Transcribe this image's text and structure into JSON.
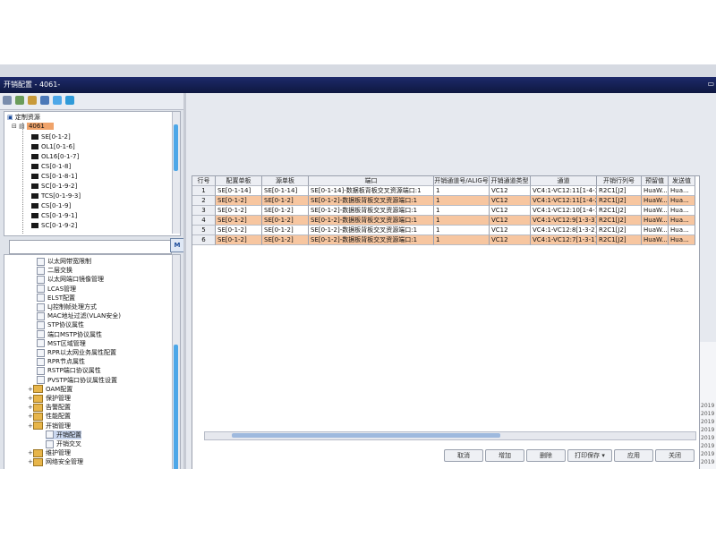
{
  "window": {
    "title": "开销配置 - 4061-"
  },
  "tree": {
    "root_label": "定制资源",
    "ne_label": "4061",
    "items": [
      {
        "label": "SE[0-1-2]"
      },
      {
        "label": "OL1[0-1-6]"
      },
      {
        "label": "OL16[0-1-7]"
      },
      {
        "label": "CS[0-1-8]"
      },
      {
        "label": "CS[0-1-8-1]"
      },
      {
        "label": "SC[0-1-9-2]"
      },
      {
        "label": "TCS[0-1-9-3]"
      },
      {
        "label": "CS[0-1-9]"
      },
      {
        "label": "CS[0-1-9-1]"
      },
      {
        "label": "SC[0-1-9-2]"
      }
    ]
  },
  "search": {
    "placeholder": "",
    "button_label": "M"
  },
  "function_tree": [
    {
      "label": "以太网带宽限制",
      "type": "leaf",
      "indent": 1
    },
    {
      "label": "二层交换",
      "type": "leaf",
      "indent": 1
    },
    {
      "label": "以太网端口镜像管理",
      "type": "leaf",
      "indent": 1
    },
    {
      "label": "LCAS管理",
      "type": "leaf",
      "indent": 1
    },
    {
      "label": "ELST配置",
      "type": "leaf",
      "indent": 1
    },
    {
      "label": "LJ控制帧处理方式",
      "type": "leaf",
      "indent": 1
    },
    {
      "label": "MAC地址过滤(VLAN安全)",
      "type": "leaf",
      "indent": 1
    },
    {
      "label": "STP协议属性",
      "type": "leaf",
      "indent": 1
    },
    {
      "label": "端口MSTP协议属性",
      "type": "leaf",
      "indent": 1
    },
    {
      "label": "MST区域管理",
      "type": "leaf",
      "indent": 1
    },
    {
      "label": "RPR以太网业务属性配置",
      "type": "leaf",
      "indent": 1
    },
    {
      "label": "RPR节点属性",
      "type": "leaf",
      "indent": 1
    },
    {
      "label": "RSTP端口协议属性",
      "type": "leaf",
      "indent": 1
    },
    {
      "label": "PVSTP端口协议属性设置",
      "type": "leaf",
      "indent": 1
    },
    {
      "label": "OAM配置",
      "type": "folder",
      "indent": 0
    },
    {
      "label": "保护管理",
      "type": "folder",
      "indent": 0
    },
    {
      "label": "告警配置",
      "type": "folder",
      "indent": 0
    },
    {
      "label": "性能配置",
      "type": "folder",
      "indent": 0
    },
    {
      "label": "开销管理",
      "type": "folder",
      "indent": 0
    },
    {
      "label": "开销配置",
      "type": "leaf",
      "indent": 2,
      "selected": true
    },
    {
      "label": "开销交叉",
      "type": "leaf",
      "indent": 2
    },
    {
      "label": "维护管理",
      "type": "folder",
      "indent": 0
    },
    {
      "label": "网络安全管理",
      "type": "folder",
      "indent": 0
    }
  ],
  "grid": {
    "headers": [
      "行号",
      "配置单板",
      "源单板",
      "端口",
      "开销通道号/ALIG号",
      "开销通道类型",
      "通道",
      "开销行列号",
      "预留值",
      "发送值"
    ],
    "rows": [
      [
        "1",
        "SE[0-1-14]",
        "SE[0-1-14]",
        "SE[0-1-14]-数据板背板交叉资源端口:1",
        "1",
        "VC12",
        "VC4:1-VC12:11[1-4-3]",
        "R2C1[J2]",
        "HuaW...",
        "Hua..."
      ],
      [
        "2",
        "SE[0-1-2]",
        "SE[0-1-2]",
        "SE[0-1-2]-数据板背板交叉资源端口:1",
        "1",
        "VC12",
        "VC4:1-VC12:11[1-4-2]",
        "R2C1[J2]",
        "HuaW...",
        "Hua..."
      ],
      [
        "3",
        "SE[0-1-2]",
        "SE[0-1-2]",
        "SE[0-1-2]-数据板背板交叉资源端口:1",
        "1",
        "VC12",
        "VC4:1-VC12:10[1-4-1]",
        "R2C1[J2]",
        "HuaW...",
        "Hua..."
      ],
      [
        "4",
        "SE[0-1-2]",
        "SE[0-1-2]",
        "SE[0-1-2]-数据板背板交叉资源端口:1",
        "1",
        "VC12",
        "VC4:1-VC12:9[1-3-3]",
        "R2C1[J2]",
        "HuaW...",
        "Hua..."
      ],
      [
        "5",
        "SE[0-1-2]",
        "SE[0-1-2]",
        "SE[0-1-2]-数据板背板交叉资源端口:1",
        "1",
        "VC12",
        "VC4:1-VC12:8[1-3-2]",
        "R2C1[J2]",
        "HuaW...",
        "Hua..."
      ],
      [
        "6",
        "SE[0-1-2]",
        "SE[0-1-2]",
        "SE[0-1-2]-数据板背板交叉资源端口:1",
        "1",
        "VC12",
        "VC4:1-VC12:7[1-3-1]",
        "R2C1[J2]",
        "HuaW...",
        "Hua..."
      ]
    ]
  },
  "buttons": {
    "query": "取消",
    "apply": "增加",
    "delete": "删除",
    "print": "打印保存",
    "print_arrow": "▾",
    "apply2": "应用",
    "close": "关闭"
  },
  "colors": {
    "selected_row": "#f7c6a0",
    "title_bar": "#0e1740"
  },
  "right_edge_dates": [
    "2019",
    "2019",
    "2019",
    "2019",
    "2019",
    "2019",
    "2019",
    "2019"
  ]
}
